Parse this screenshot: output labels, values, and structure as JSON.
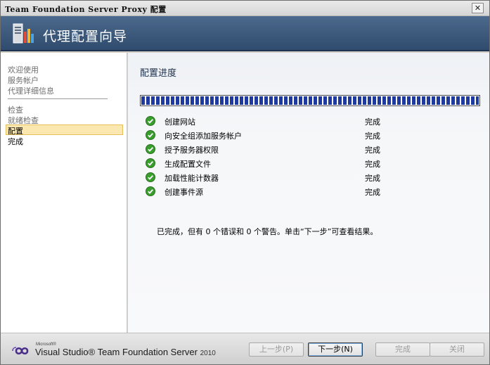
{
  "window": {
    "title": "Team Foundation Server Proxy 配置",
    "close_glyph": "✕"
  },
  "header": {
    "title": "代理配置向导",
    "icon": "server-config-icon"
  },
  "sidebar": {
    "items": [
      {
        "label": "欢迎使用",
        "state": "done"
      },
      {
        "label": "服务帐户",
        "state": "done"
      },
      {
        "label": "代理详细信息",
        "state": "done"
      },
      {
        "label": "检查",
        "state": "done"
      },
      {
        "label": "就绪检查",
        "state": "done"
      },
      {
        "label": "配置",
        "state": "selected"
      },
      {
        "label": "完成",
        "state": "pending"
      }
    ]
  },
  "main": {
    "section_title": "配置进度",
    "progress_percent": 100,
    "tasks": [
      {
        "name": "创建网站",
        "status": "完成"
      },
      {
        "name": "向安全组添加服务帐户",
        "status": "完成"
      },
      {
        "name": "授予服务器权限",
        "status": "完成"
      },
      {
        "name": "生成配置文件",
        "status": "完成"
      },
      {
        "name": "加载性能计数器",
        "status": "完成"
      },
      {
        "name": "创建事件源",
        "status": "完成"
      }
    ],
    "summary": "已完成，但有 0 个错误和 0 个警告。单击“下一步”可查看结果。"
  },
  "footer": {
    "logo_ms": "Microsoft®",
    "logo_text": "Visual Studio® Team Foundation Server",
    "logo_year": "2010",
    "buttons": {
      "back": "上一步(P)",
      "next": "下一步(N)",
      "finish": "完成",
      "close": "关闭"
    }
  },
  "colors": {
    "banner": "#3b5879",
    "progress": "#1f3a9e",
    "check": "#3a9d2e",
    "selected_nav": "#fbe8b0"
  }
}
